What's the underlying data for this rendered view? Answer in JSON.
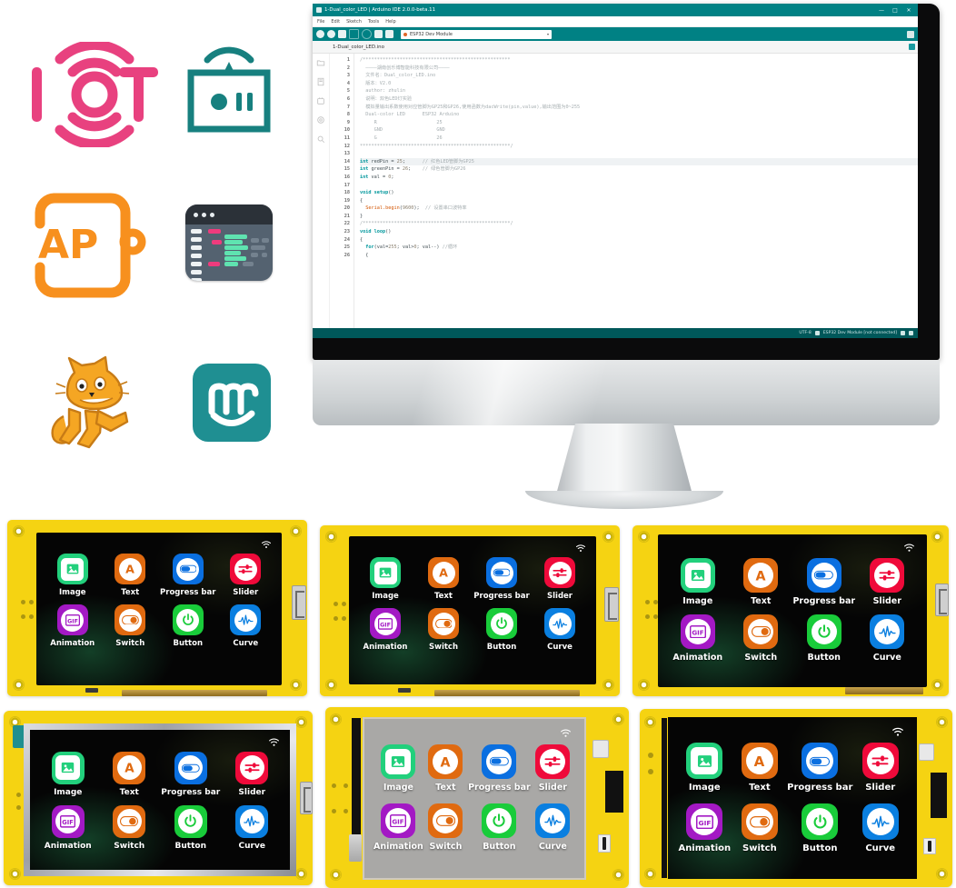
{
  "left_icons": [
    {
      "name": "iot-logo",
      "label": "IOT",
      "color": "#e8417f"
    },
    {
      "name": "screen-app-icon",
      "label": "",
      "color": "#17807f"
    },
    {
      "name": "app-icon",
      "label": "APP",
      "color": "#f7901e"
    },
    {
      "name": "code-editor-icon",
      "label": "",
      "color": "#546270"
    },
    {
      "name": "scratch-cat-icon",
      "label": "",
      "color": "#f5a623"
    },
    {
      "name": "mblock-icon",
      "label": "m",
      "color": "#1f8f92"
    }
  ],
  "monitor": {
    "ide": {
      "title": "1-Dual_color_LED | Arduino IDE 2.0.0-beta.11",
      "window_buttons": [
        "—",
        "□",
        "✕"
      ],
      "menu": [
        "File",
        "Edit",
        "Sketch",
        "Tools",
        "Help"
      ],
      "board_selector": "ESP32 Dev Module",
      "tab": "1-Dual_color_LED.ino",
      "status_encoding": "UTF-8",
      "status_board": "ESP32 Dev Module [not connected]",
      "rail_icons": [
        "folder-icon",
        "book-icon",
        "board-manager-icon",
        "library-icon",
        "search-icon"
      ],
      "toolbar_icons": [
        "verify-icon",
        "upload-icon",
        "new-sketch-icon",
        "open-icon",
        "save-icon",
        "debug-icon",
        "serial-plotter-icon"
      ],
      "line_numbers": [
        1,
        2,
        3,
        4,
        5,
        6,
        7,
        8,
        9,
        10,
        11,
        12,
        13,
        14,
        15,
        16,
        17,
        18,
        19,
        20,
        21,
        22,
        23,
        24,
        25,
        26
      ],
      "code_lines": [
        {
          "n": 1,
          "t": "/****************************************************",
          "c": "cm"
        },
        {
          "n": 2,
          "t": "  ————湖南创乐博智能科技有限公司————",
          "c": "cm"
        },
        {
          "n": 3,
          "t": "  文件名：Dual_color_LED.ino",
          "c": "cm"
        },
        {
          "n": 4,
          "t": "  版本：V2.0",
          "c": "cm"
        },
        {
          "n": 5,
          "t": "  author: zhulin",
          "c": "cm"
        },
        {
          "n": 6,
          "t": "  说明：双色LED灯实验",
          "c": "cm"
        },
        {
          "n": 7,
          "t": "  模拟量输出系数使用对应管脚为GP25和GP26,使用函数为dacWrite(pin,value),输出范围为0~255",
          "c": "cm"
        },
        {
          "n": 8,
          "t": "  Dual-color LED      ESP32 Arduino",
          "c": "cm"
        },
        {
          "n": 9,
          "t": "     R                     25",
          "c": "cm"
        },
        {
          "n": 10,
          "t": "     GND                   GND",
          "c": "cm"
        },
        {
          "n": 11,
          "t": "     G                     26",
          "c": "cm"
        },
        {
          "n": 12,
          "t": "*****************************************************/",
          "c": "cm"
        },
        {
          "n": 13,
          "t": "",
          "c": ""
        },
        {
          "n": 14,
          "t": "int redPin = 25;      // 红色LED管脚为GP25",
          "c": "code-a"
        },
        {
          "n": 15,
          "t": "int greenPin = 26;    // 绿色管脚为GP26",
          "c": "code-b"
        },
        {
          "n": 16,
          "t": "int val = 0;",
          "c": "code-c"
        },
        {
          "n": 17,
          "t": "",
          "c": ""
        },
        {
          "n": 18,
          "t": "void setup()",
          "c": "code-d"
        },
        {
          "n": 19,
          "t": "{",
          "c": ""
        },
        {
          "n": 20,
          "t": "  Serial.begin(9600);  // 设置串口波特率",
          "c": "code-e"
        },
        {
          "n": 21,
          "t": "}",
          "c": ""
        },
        {
          "n": 22,
          "t": "/****************************************************/",
          "c": "cm"
        },
        {
          "n": 23,
          "t": "void loop()",
          "c": "code-f"
        },
        {
          "n": 24,
          "t": "{",
          "c": ""
        },
        {
          "n": 25,
          "t": "  for(val=255; val>0; val--) //循环",
          "c": "code-g"
        },
        {
          "n": 26,
          "t": "  {",
          "c": ""
        }
      ]
    }
  },
  "display_demo": {
    "wifi_icon": "wifi-icon",
    "apps": [
      {
        "label": "Image",
        "icon": "image-icon",
        "color": "#22d07c",
        "shape": "sq"
      },
      {
        "label": "Text",
        "icon": "text-a-icon",
        "color": "#e06a10",
        "shape": "circle"
      },
      {
        "label": "Progress bar",
        "icon": "progress-bar-icon",
        "color": "#0a6fe0",
        "shape": "circle"
      },
      {
        "label": "Slider",
        "icon": "slider-icon",
        "color": "#ef0a3a",
        "shape": "circle"
      },
      {
        "label": "Animation",
        "icon": "gif-icon",
        "color": "#a319c4",
        "shape": "circle"
      },
      {
        "label": "Switch",
        "icon": "toggle-switch-icon",
        "color": "#e06a10",
        "shape": "circle"
      },
      {
        "label": "Button",
        "icon": "power-button-icon",
        "color": "#19cc3a",
        "shape": "circle"
      },
      {
        "label": "Curve",
        "icon": "waveform-icon",
        "color": "#0a7fe0",
        "shape": "circle"
      }
    ]
  },
  "boards": [
    {
      "id": "board-top-left",
      "variant": "yellow-landscape",
      "screen": "black"
    },
    {
      "id": "board-top-mid",
      "variant": "yellow-landscape",
      "screen": "black"
    },
    {
      "id": "board-top-right",
      "variant": "yellow-wide",
      "screen": "black"
    },
    {
      "id": "board-bottom-left",
      "variant": "yellow-silver",
      "screen": "black"
    },
    {
      "id": "board-bottom-mid",
      "variant": "yellow-portrait",
      "screen": "gray"
    },
    {
      "id": "board-bottom-right",
      "variant": "yellow-tall",
      "screen": "black"
    }
  ]
}
